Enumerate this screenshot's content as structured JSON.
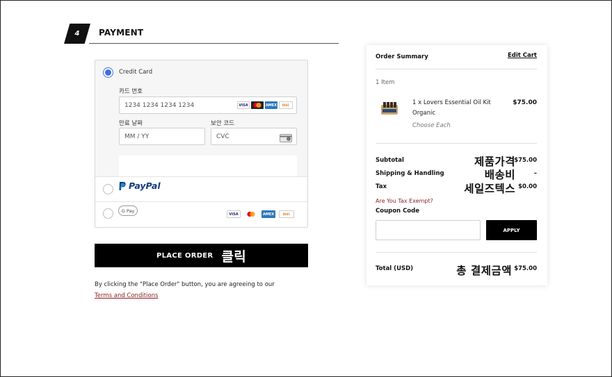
{
  "payment": {
    "step": "4",
    "title": "PAYMENT",
    "credit_card_label": "Credit Card",
    "card_number_label": "카드 번호",
    "card_number_placeholder": "1234 1234 1234 1234",
    "expiry_label": "만료 날짜",
    "expiry_placeholder": "MM / YY",
    "cvc_label": "보안 코드",
    "cvc_placeholder": "CVC",
    "card_brands": [
      "VISA",
      "MC",
      "AMEX",
      "DISCOVER"
    ],
    "paypal_label": "PayPal",
    "gpay_label": "G Pay",
    "selected_method": "credit-card"
  },
  "place_order": {
    "label": "PLACE ORDER",
    "annotation": "클릭",
    "agree_text": "By clicking the \"Place Order\" button, you are agreeing to our",
    "terms_link": "Terms and Conditions"
  },
  "summary": {
    "title": "Order Summary",
    "edit_cart": "Edit Cart",
    "items_count": "1 Item",
    "product": {
      "name": "1 x Lovers Essential Oil Kit Organic",
      "variant": "Choose Each",
      "price": "$75.00"
    },
    "rows": [
      {
        "label": "Subtotal",
        "value": "$75.00",
        "annotation": "제품가격"
      },
      {
        "label": "Shipping & Handling",
        "value": "–",
        "annotation": "배송비"
      },
      {
        "label": "Tax",
        "value": "$0.00",
        "annotation": "세일즈텍스"
      }
    ],
    "tax_exempt_link": "Are You Tax Exempt?",
    "coupon_label": "Coupon Code",
    "apply_label": "APPLY",
    "total_label": "Total (USD)",
    "total_value": "$75.00",
    "total_annotation": "총 결제금액"
  },
  "colors": {
    "accent_blue": "#3b6fe0",
    "link_red": "#8a1f1f",
    "button_black": "#000000"
  }
}
